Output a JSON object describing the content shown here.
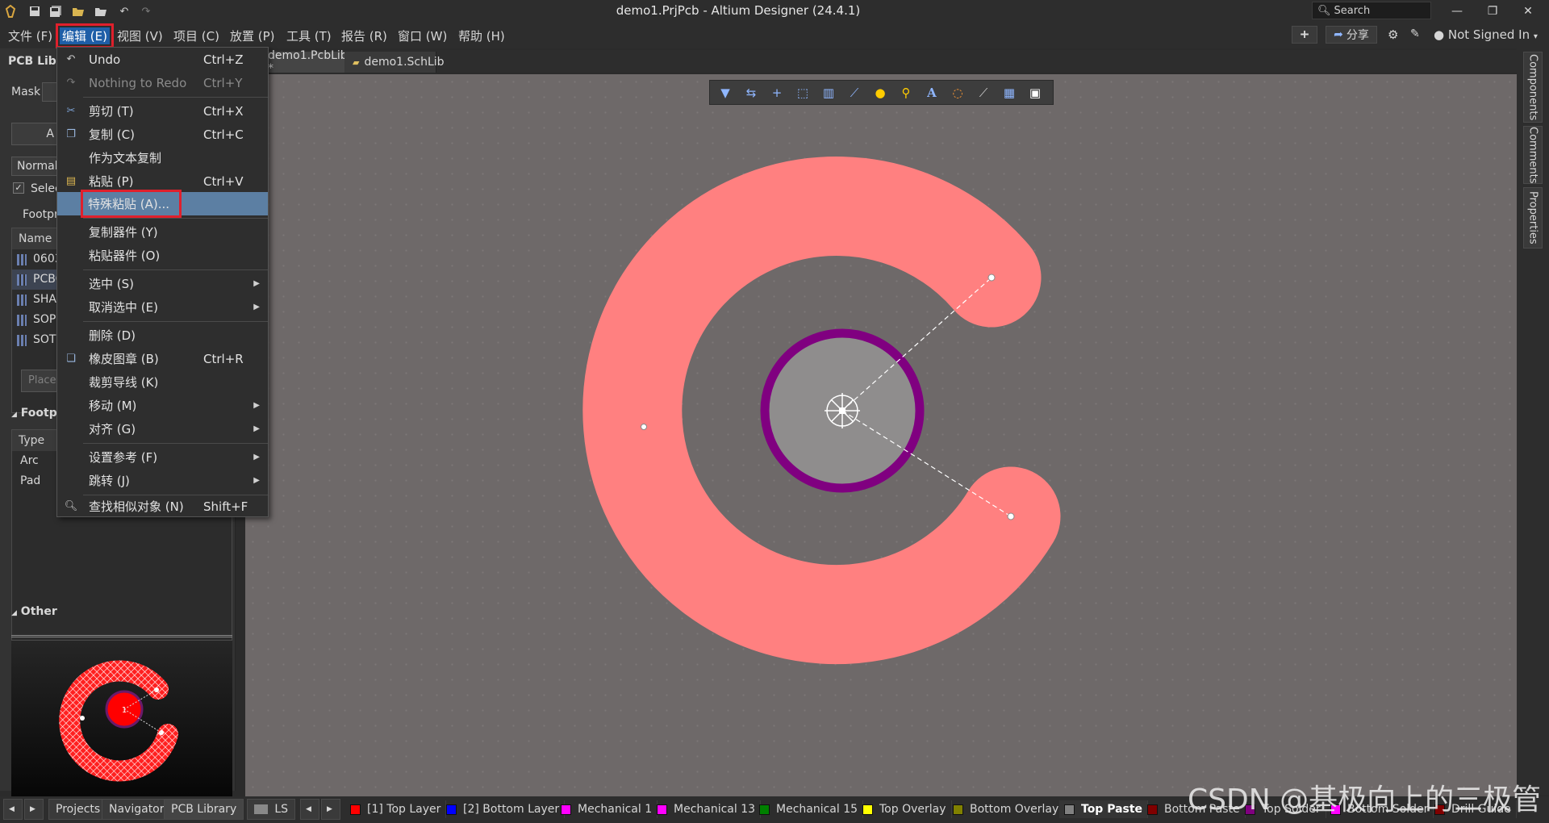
{
  "window": {
    "title": "demo1.PrjPcb - Altium Designer (24.4.1)",
    "search_placeholder": "Search",
    "minimize": "—",
    "restore": "❐",
    "close": "✕"
  },
  "menubar": {
    "items": [
      "文件 (F)",
      "编辑 (E)",
      "视图 (V)",
      "项目 (C)",
      "放置 (P)",
      "工具 (T)",
      "报告 (R)",
      "窗口 (W)",
      "帮助 (H)"
    ],
    "active_item": "编辑 (E)",
    "share_label": "分享",
    "user_label": "Not Signed In"
  },
  "left_panel": {
    "title": "PCB Libr",
    "mask_label": "Mask",
    "apply_button": "A",
    "normal_select": "Normal",
    "select_checkbox": "Selec",
    "footprints_section": "Footpr",
    "name_column": "Name",
    "footprints": [
      "0603",
      "PCBC",
      "SHAI",
      "SOP8",
      "SOT2"
    ],
    "place_button": "Place",
    "footprint_primitives_title": "Footpr",
    "type_column": "Type",
    "primitives": [
      "Arc",
      "Pad"
    ],
    "other_title": "Other",
    "preview_pad_number": "1"
  },
  "doc_tabs": [
    {
      "label": "demo1.PcbLib *"
    },
    {
      "label": "demo1.SchLib"
    }
  ],
  "right_tabs": [
    "Components",
    "Comments",
    "Properties"
  ],
  "edit_menu": {
    "items": [
      {
        "icon": "undo-icon",
        "label": "Undo",
        "shortcut": "Ctrl+Z"
      },
      {
        "icon": "redo-icon",
        "label": "Nothing to Redo",
        "shortcut": "Ctrl+Y",
        "disabled": true
      },
      {
        "icon": "cut-icon",
        "label": "剪切 (T)",
        "shortcut": "Ctrl+X"
      },
      {
        "icon": "copy-icon",
        "label": "复制 (C)",
        "shortcut": "Ctrl+C"
      },
      {
        "icon": "",
        "label": "作为文本复制",
        "shortcut": ""
      },
      {
        "icon": "paste-icon",
        "label": "粘贴 (P)",
        "shortcut": "Ctrl+V"
      },
      {
        "icon": "",
        "label": "特殊粘贴 (A)...",
        "shortcut": "",
        "highlight": true
      },
      {
        "icon": "",
        "label": "复制器件 (Y)",
        "shortcut": ""
      },
      {
        "icon": "",
        "label": "粘贴器件 (O)",
        "shortcut": ""
      },
      {
        "icon": "",
        "label": "选中 (S)",
        "shortcut": "",
        "submenu": true
      },
      {
        "icon": "",
        "label": "取消选中 (E)",
        "shortcut": "",
        "submenu": true
      },
      {
        "icon": "",
        "label": "删除 (D)",
        "shortcut": ""
      },
      {
        "icon": "stamp-icon",
        "label": "橡皮图章 (B)",
        "shortcut": "Ctrl+R"
      },
      {
        "icon": "",
        "label": "裁剪导线 (K)",
        "shortcut": ""
      },
      {
        "icon": "",
        "label": "移动 (M)",
        "shortcut": "",
        "submenu": true
      },
      {
        "icon": "",
        "label": "对齐 (G)",
        "shortcut": "",
        "submenu": true
      },
      {
        "icon": "",
        "label": "设置参考 (F)",
        "shortcut": "",
        "submenu": true
      },
      {
        "icon": "",
        "label": "跳转 (J)",
        "shortcut": "",
        "submenu": true
      },
      {
        "icon": "search-icon",
        "label": "查找相似对象 (N)",
        "shortcut": "Shift+F"
      }
    ]
  },
  "status_bar": {
    "panel_tabs": [
      "Projects",
      "Navigator",
      "PCB Library"
    ],
    "ls_label": "LS",
    "layers": [
      {
        "name": "[1] Top Layer",
        "color": "#ff0000"
      },
      {
        "name": "[2] Bottom Layer",
        "color": "#0000ff"
      },
      {
        "name": "Mechanical 1",
        "color": "#ff00ff"
      },
      {
        "name": "Mechanical 13",
        "color": "#ff00ff"
      },
      {
        "name": "Mechanical 15",
        "color": "#008000"
      },
      {
        "name": "Top Overlay",
        "color": "#ffff00"
      },
      {
        "name": "Bottom Overlay",
        "color": "#808000"
      },
      {
        "name": "Top Paste",
        "color": "#808080",
        "active": true
      },
      {
        "name": "Bottom Paste",
        "color": "#800000"
      },
      {
        "name": "Top Solder",
        "color": "#800080"
      },
      {
        "name": "Bottom Solder",
        "color": "#ff00ff"
      },
      {
        "name": "Drill Guide",
        "color": "#800000"
      }
    ]
  },
  "watermark": "CSDN @基极向上的三极管",
  "colors": {
    "arc_fill": "#ff8080",
    "pad_ring": "#800080",
    "pad_center": "#8f8d8d",
    "canvas_bg": "#6e6969",
    "highlight": "#5c7fa3",
    "outline_red": "#e0202c"
  }
}
